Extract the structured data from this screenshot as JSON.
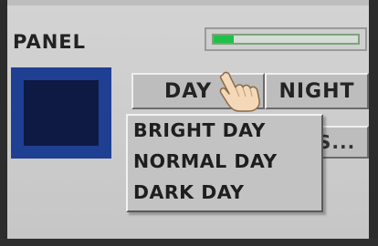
{
  "panel": {
    "title": "PANEL"
  },
  "progress": {
    "value_percent": 14,
    "fill_color": "#1fc04a"
  },
  "color_swatch": {
    "outer_color": "#1f3f93",
    "inner_color": "#0e1a44"
  },
  "mode_buttons": {
    "day_label": "DAY",
    "night_label": "NIGHT"
  },
  "hidden_button": {
    "label_fragment": "S..."
  },
  "dropdown": {
    "items": [
      {
        "label": "BRIGHT DAY"
      },
      {
        "label": "NORMAL DAY"
      },
      {
        "label": "DARK DAY"
      }
    ]
  },
  "cursor": {
    "icon": "hand-pointer-icon"
  }
}
